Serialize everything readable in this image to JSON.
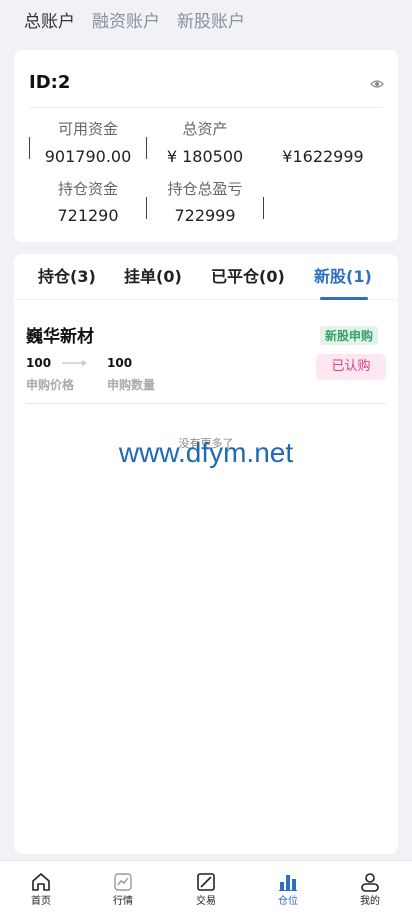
{
  "account_tabs": [
    "总账户",
    "融资账户",
    "新股账户"
  ],
  "account": {
    "id": "ID:2",
    "available_label": "可用资金",
    "available_value": "901790.00",
    "total_label": "总资产",
    "total_value": "¥ 180500",
    "extra_value": "¥1622999",
    "holding_label": "持仓资金",
    "holding_value": "721290",
    "pnl_label": "持仓总盈亏",
    "pnl_value": "722999"
  },
  "position_tabs": [
    "持仓(3)",
    "挂单(0)",
    "已平仓(0)",
    "新股(1)"
  ],
  "active_position_tab": 3,
  "ipo": {
    "name": "巍华新材",
    "badge": "新股申购",
    "status": "已认购",
    "price_value": "100",
    "price_label": "申购价格",
    "qty_value": "100",
    "qty_label": "申购数量"
  },
  "no_more": "没有更多了",
  "watermark": "www.dfym.net",
  "nav": [
    {
      "label": "首页",
      "icon": "home-icon"
    },
    {
      "label": "行情",
      "icon": "chart-icon"
    },
    {
      "label": "交易",
      "icon": "trade-icon"
    },
    {
      "label": "仓位",
      "icon": "position-icon"
    },
    {
      "label": "我的",
      "icon": "user-icon"
    }
  ],
  "colors": {
    "accent": "#2f6fc2",
    "badge_green": "#3aa36b",
    "badge_pink": "#d6437e"
  }
}
